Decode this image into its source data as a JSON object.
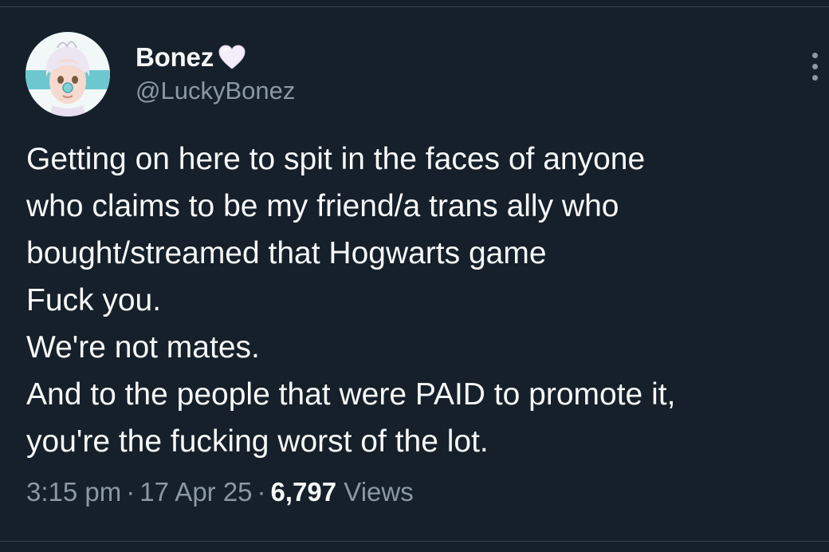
{
  "author": {
    "display_name": "Bonez",
    "handle": "@LuckyBonez",
    "name_emoji": "white-heart-icon"
  },
  "tweet": {
    "lines": [
      "Getting on here to spit in the faces of anyone",
      "who claims to be my friend/a trans ally who",
      "bought/streamed that Hogwarts game",
      "Fuck you.",
      "We're not mates.",
      "And to the people that were PAID to promote it,",
      "you're the fucking worst of the lot."
    ]
  },
  "meta": {
    "time": "3:15 pm",
    "separator": "·",
    "date": "17 Apr 25",
    "views_count": "6,797",
    "views_label": "Views"
  },
  "colors": {
    "background": "#15202b",
    "primary_text": "#f7f9f9",
    "secondary_text": "#8b98a5",
    "divider": "#38444d"
  }
}
